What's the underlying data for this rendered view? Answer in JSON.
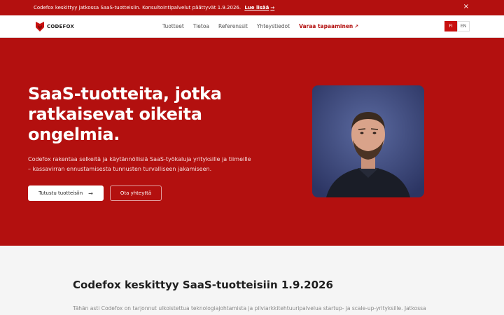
{
  "announcement": {
    "text": "Codefox keskittyy jatkossa SaaS-tuotteisiin. Konsultointipalvelut päättyvät 1.9.2026.",
    "link_label": "Lue lisää",
    "arrow": "→",
    "close": "×"
  },
  "header": {
    "logo_text": "CODEFOX",
    "nav": [
      "Tuotteet",
      "Tietoa",
      "Referenssit",
      "Yhteystiedot"
    ],
    "cta": "Varaa tapaaminen",
    "cta_icon": "external-link-icon",
    "languages": [
      "FI",
      "EN"
    ],
    "active_language": "FI"
  },
  "hero": {
    "title": "SaaS-tuotteita, jotka ratkaisevat oikeita ongelmia.",
    "description": "Codefox rakentaa selkeitä ja käytännöllisiä SaaS-työkaluja yrityksille ja tiimeille – kassavirran ennustamisesta tunnusten turvalliseen jakamiseen.",
    "primary_button": "Tutustu tuotteisiin",
    "primary_arrow": "→",
    "secondary_button": "Ota yhteyttä"
  },
  "section": {
    "title": "Codefox keskittyy SaaS-tuotteisiin 1.9.2026",
    "text": "Tähän asti Codefox on tarjonnut ulkoistettua teknologiajohtamista ja pilviarkkitehtuuripalvelua startup- ja scale-up-yrityksille. Jatkossa"
  },
  "colors": {
    "brand_red": "#b3100f",
    "white": "#ffffff"
  }
}
